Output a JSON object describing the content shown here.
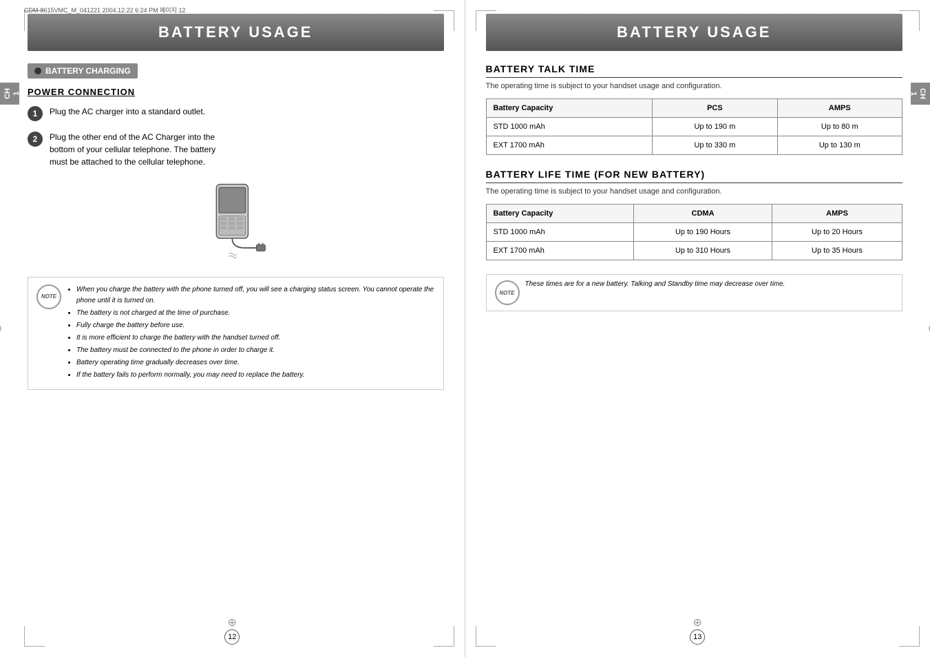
{
  "left": {
    "file_info": "CDM-8615VMC_M_041221  2004.12.22 6:24 PM  페이지 12",
    "header": "BATTERY USAGE",
    "section_title": "BATTERY CHARGING",
    "subsection_title": "POWER CONNECTION",
    "step1": "Plug the AC charger into a standard outlet.",
    "step2_line1": "Plug the other end of the AC Charger into the",
    "step2_line2": "bottom of your cellular telephone. The battery",
    "step2_line3": "must be attached to the cellular telephone.",
    "note_items": [
      "When you charge the battery with the phone turned off, you will see a charging status screen. You cannot operate the phone until it is turned on.",
      "The battery is not charged at the time of purchase.",
      "Fully charge the battery before use.",
      "It is more efficient to charge the battery with the handset turned off.",
      "The battery must be connected to the phone in order to charge it.",
      "Battery operating time gradually decreases over time.",
      "If the battery fails to perform normally, you may need to replace the battery."
    ],
    "page_number": "12",
    "chapter": "CH",
    "chapter_num": "1"
  },
  "right": {
    "header": "BATTERY USAGE",
    "section1_title": "BATTERY TALK TIME",
    "section1_subtitle": "The operating time is subject to your handset usage and configuration.",
    "table1": {
      "headers": [
        "Battery Capacity",
        "PCS",
        "AMPS"
      ],
      "rows": [
        [
          "STD 1000 mAh",
          "Up to 190 m",
          "Up to 80 m"
        ],
        [
          "EXT 1700 mAh",
          "Up to 330 m",
          "Up to 130 m"
        ]
      ]
    },
    "section2_title": "BATTERY LIFE TIME (FOR NEW BATTERY)",
    "section2_subtitle": "The operating time is subject to your handset usage and configuration.",
    "table2": {
      "headers": [
        "Battery Capacity",
        "CDMA",
        "AMPS"
      ],
      "rows": [
        [
          "STD 1000 mAh",
          "Up to 190 Hours",
          "Up to 20 Hours"
        ],
        [
          "EXT 1700 mAh",
          "Up to 310 Hours",
          "Up to 35 Hours"
        ]
      ]
    },
    "note_text": "These times are for a new battery. Talking and Standby time may decrease over time.",
    "page_number": "13",
    "chapter": "CH",
    "chapter_num": "1"
  }
}
